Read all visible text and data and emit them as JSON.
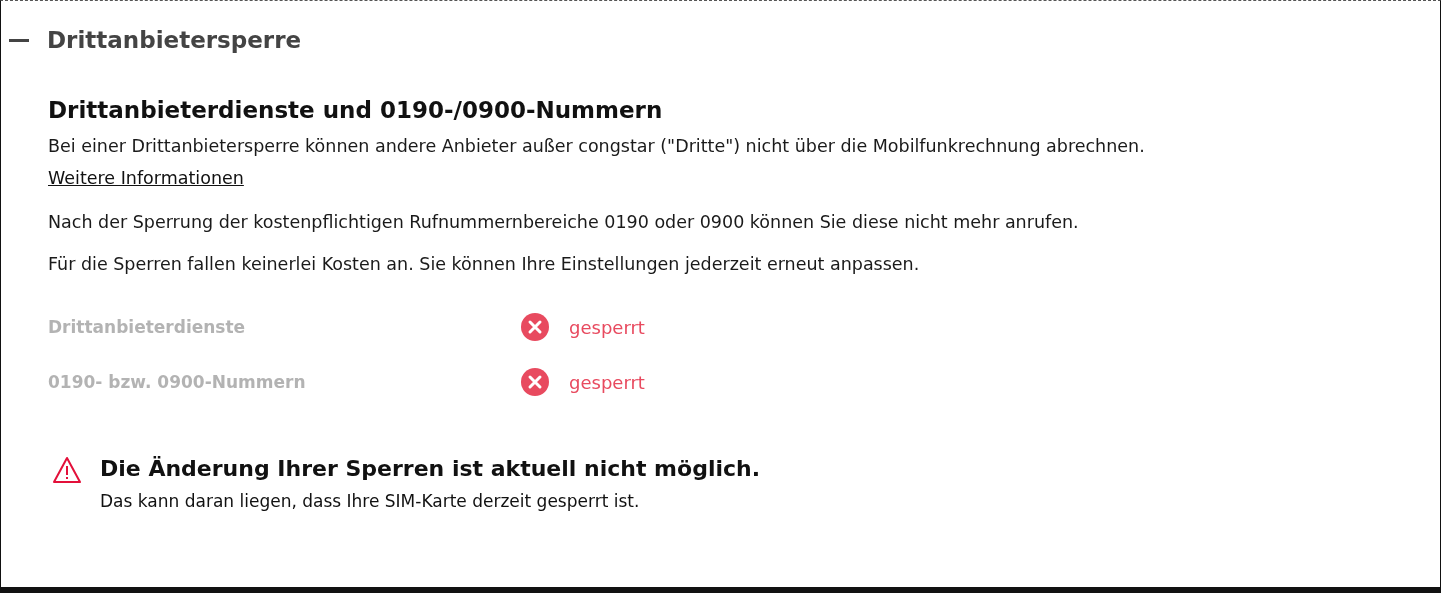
{
  "section": {
    "title": "Drittanbietersperre",
    "expanded": true
  },
  "heading": "Drittanbieterdienste und 0190-/0900-Nummern",
  "intro": "Bei einer Drittanbietersperre können andere Anbieter außer congstar (\"Dritte\") nicht über die Mobilfunkrechnung abrechnen.",
  "link": "Weitere Informationen",
  "paragraphs": [
    "Nach der Sperrung der kostenpflichtigen Rufnummernbereiche 0190 oder 0900 können Sie diese nicht mehr anrufen.",
    "Für die Sperren fallen keinerlei Kosten an. Sie können Ihre Einstellungen jederzeit erneut anpassen."
  ],
  "locks": [
    {
      "label": "Drittanbieterdienste",
      "kind": "blocked",
      "status_text": "gesperrt",
      "disabled": true
    },
    {
      "label": "0190- bzw. 0900-Nummern",
      "kind": "blocked",
      "status_text": "gesperrt",
      "disabled": true
    }
  ],
  "warning": {
    "title": "Die Änderung Ihrer Sperren ist aktuell nicht möglich.",
    "text": "Das kann daran liegen, dass Ihre SIM-Karte derzeit gesperrt ist."
  }
}
